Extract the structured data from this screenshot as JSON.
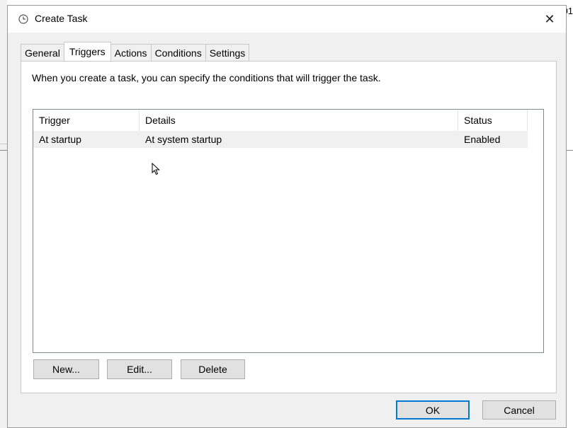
{
  "background": {
    "corner_text": "01"
  },
  "dialog": {
    "title": "Create Task",
    "close_label": "✕"
  },
  "tabs": [
    {
      "label": "General",
      "active": false
    },
    {
      "label": "Triggers",
      "active": true
    },
    {
      "label": "Actions",
      "active": false
    },
    {
      "label": "Conditions",
      "active": false
    },
    {
      "label": "Settings",
      "active": false
    }
  ],
  "triggers_tab": {
    "description": "When you create a task, you can specify the conditions that will trigger the task.",
    "columns": [
      "Trigger",
      "Details",
      "Status"
    ],
    "rows": [
      {
        "trigger": "At startup",
        "details": "At system startup",
        "status": "Enabled"
      }
    ],
    "new_button": "New...",
    "edit_button": "Edit...",
    "delete_button": "Delete"
  },
  "footer": {
    "ok_button": "OK",
    "cancel_button": "Cancel"
  },
  "colors": {
    "dialog_bg": "#f0f0f0",
    "focus_border": "#0078d7",
    "row_highlight": "#f0f0f0"
  },
  "icons": {
    "title": "clock-icon",
    "close": "close-icon",
    "cursor": "mouse-pointer-icon"
  }
}
